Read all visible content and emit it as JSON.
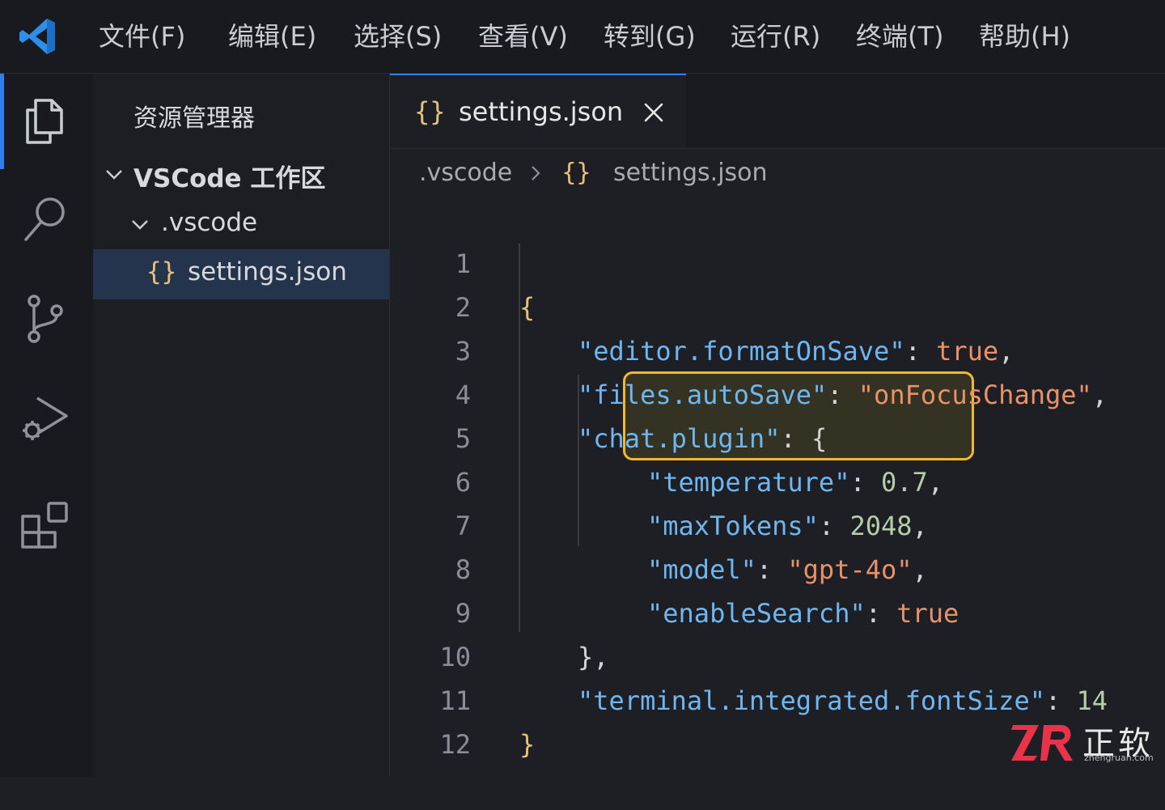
{
  "menu": [
    {
      "label": "文件(F)"
    },
    {
      "label": "编辑(E)"
    },
    {
      "label": "选择(S)"
    },
    {
      "label": "查看(V)"
    },
    {
      "label": "转到(G)"
    },
    {
      "label": "运行(R)"
    },
    {
      "label": "终端(T)"
    },
    {
      "label": "帮助(H)"
    }
  ],
  "activity": [
    "explorer-icon",
    "search-icon",
    "source-control-icon",
    "run-debug-icon",
    "extensions-icon"
  ],
  "sidebar": {
    "title": "资源管理器",
    "workspace": "VSCode 工作区",
    "folder": ".vscode",
    "file": "settings.json"
  },
  "tab": {
    "braces": "{}",
    "label": "settings.json"
  },
  "breadcrumb": {
    "folder": ".vscode",
    "braces": "{}",
    "file": "settings.json"
  },
  "code": {
    "line_numbers": [
      "1",
      "2",
      "3",
      "4",
      "5",
      "6",
      "7",
      "8",
      "9",
      "10",
      "11",
      "12"
    ],
    "l1": {
      "brace": "{"
    },
    "l2": {
      "key": "\"editor.formatOnSave\"",
      "colon": ": ",
      "value": "true",
      "comma": ","
    },
    "l3": {
      "key": "\"files.autoSave\"",
      "colon": ": ",
      "value": "\"onFocusChange\"",
      "comma": ","
    },
    "l4": {
      "key": "\"chat.plugin\"",
      "colon": ": ",
      "brace": "{"
    },
    "l5": {
      "key": "\"temperature\"",
      "colon": ": ",
      "value": "0.7",
      "comma": ","
    },
    "l6": {
      "key": "\"maxTokens\"",
      "colon": ": ",
      "value": "2048",
      "comma": ","
    },
    "l7": {
      "key": "\"model\"",
      "colon": ": ",
      "value": "\"gpt-4o\"",
      "comma": ","
    },
    "l8": {
      "key": "\"enableSearch\"",
      "colon": ": ",
      "value": "true"
    },
    "l9": {
      "text": "},"
    },
    "l10": {
      "key": "\"terminal.integrated.fontSize\"",
      "colon": ": ",
      "value": "14"
    },
    "l11": {
      "brace": "}"
    }
  },
  "watermark": {
    "cn": "正软",
    "url": "zhengruan.com"
  },
  "colors": {
    "accent": "#2f80ed",
    "highlight_border": "#f1b92f",
    "json_key": "#6fb6f0",
    "json_string": "#e8926a",
    "json_number": "#b5cea8",
    "brace": "#e5c07b"
  }
}
